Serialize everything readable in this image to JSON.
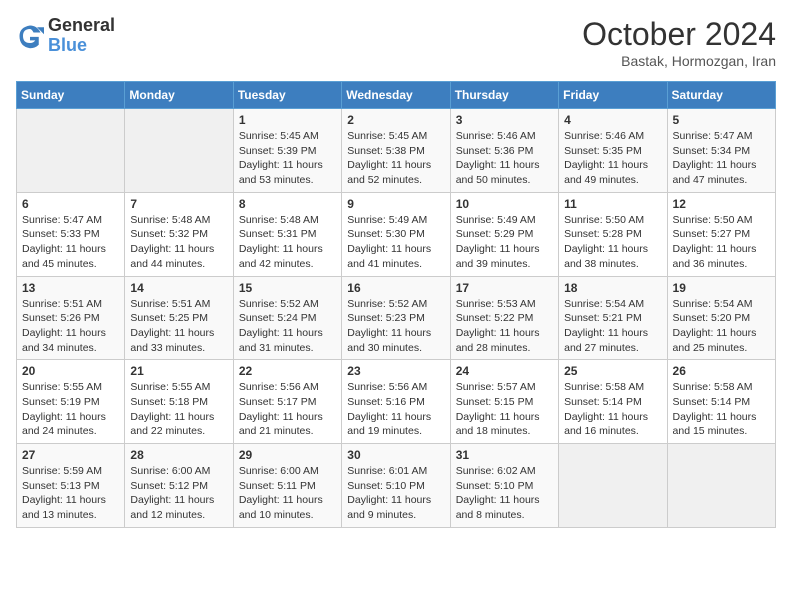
{
  "logo": {
    "line1": "General",
    "line2": "Blue"
  },
  "title": "October 2024",
  "subtitle": "Bastak, Hormozgan, Iran",
  "days_of_week": [
    "Sunday",
    "Monday",
    "Tuesday",
    "Wednesday",
    "Thursday",
    "Friday",
    "Saturday"
  ],
  "weeks": [
    [
      {
        "day": "",
        "info": ""
      },
      {
        "day": "",
        "info": ""
      },
      {
        "day": "1",
        "info": "Sunrise: 5:45 AM\nSunset: 5:39 PM\nDaylight: 11 hours and 53 minutes."
      },
      {
        "day": "2",
        "info": "Sunrise: 5:45 AM\nSunset: 5:38 PM\nDaylight: 11 hours and 52 minutes."
      },
      {
        "day": "3",
        "info": "Sunrise: 5:46 AM\nSunset: 5:36 PM\nDaylight: 11 hours and 50 minutes."
      },
      {
        "day": "4",
        "info": "Sunrise: 5:46 AM\nSunset: 5:35 PM\nDaylight: 11 hours and 49 minutes."
      },
      {
        "day": "5",
        "info": "Sunrise: 5:47 AM\nSunset: 5:34 PM\nDaylight: 11 hours and 47 minutes."
      }
    ],
    [
      {
        "day": "6",
        "info": "Sunrise: 5:47 AM\nSunset: 5:33 PM\nDaylight: 11 hours and 45 minutes."
      },
      {
        "day": "7",
        "info": "Sunrise: 5:48 AM\nSunset: 5:32 PM\nDaylight: 11 hours and 44 minutes."
      },
      {
        "day": "8",
        "info": "Sunrise: 5:48 AM\nSunset: 5:31 PM\nDaylight: 11 hours and 42 minutes."
      },
      {
        "day": "9",
        "info": "Sunrise: 5:49 AM\nSunset: 5:30 PM\nDaylight: 11 hours and 41 minutes."
      },
      {
        "day": "10",
        "info": "Sunrise: 5:49 AM\nSunset: 5:29 PM\nDaylight: 11 hours and 39 minutes."
      },
      {
        "day": "11",
        "info": "Sunrise: 5:50 AM\nSunset: 5:28 PM\nDaylight: 11 hours and 38 minutes."
      },
      {
        "day": "12",
        "info": "Sunrise: 5:50 AM\nSunset: 5:27 PM\nDaylight: 11 hours and 36 minutes."
      }
    ],
    [
      {
        "day": "13",
        "info": "Sunrise: 5:51 AM\nSunset: 5:26 PM\nDaylight: 11 hours and 34 minutes."
      },
      {
        "day": "14",
        "info": "Sunrise: 5:51 AM\nSunset: 5:25 PM\nDaylight: 11 hours and 33 minutes."
      },
      {
        "day": "15",
        "info": "Sunrise: 5:52 AM\nSunset: 5:24 PM\nDaylight: 11 hours and 31 minutes."
      },
      {
        "day": "16",
        "info": "Sunrise: 5:52 AM\nSunset: 5:23 PM\nDaylight: 11 hours and 30 minutes."
      },
      {
        "day": "17",
        "info": "Sunrise: 5:53 AM\nSunset: 5:22 PM\nDaylight: 11 hours and 28 minutes."
      },
      {
        "day": "18",
        "info": "Sunrise: 5:54 AM\nSunset: 5:21 PM\nDaylight: 11 hours and 27 minutes."
      },
      {
        "day": "19",
        "info": "Sunrise: 5:54 AM\nSunset: 5:20 PM\nDaylight: 11 hours and 25 minutes."
      }
    ],
    [
      {
        "day": "20",
        "info": "Sunrise: 5:55 AM\nSunset: 5:19 PM\nDaylight: 11 hours and 24 minutes."
      },
      {
        "day": "21",
        "info": "Sunrise: 5:55 AM\nSunset: 5:18 PM\nDaylight: 11 hours and 22 minutes."
      },
      {
        "day": "22",
        "info": "Sunrise: 5:56 AM\nSunset: 5:17 PM\nDaylight: 11 hours and 21 minutes."
      },
      {
        "day": "23",
        "info": "Sunrise: 5:56 AM\nSunset: 5:16 PM\nDaylight: 11 hours and 19 minutes."
      },
      {
        "day": "24",
        "info": "Sunrise: 5:57 AM\nSunset: 5:15 PM\nDaylight: 11 hours and 18 minutes."
      },
      {
        "day": "25",
        "info": "Sunrise: 5:58 AM\nSunset: 5:14 PM\nDaylight: 11 hours and 16 minutes."
      },
      {
        "day": "26",
        "info": "Sunrise: 5:58 AM\nSunset: 5:14 PM\nDaylight: 11 hours and 15 minutes."
      }
    ],
    [
      {
        "day": "27",
        "info": "Sunrise: 5:59 AM\nSunset: 5:13 PM\nDaylight: 11 hours and 13 minutes."
      },
      {
        "day": "28",
        "info": "Sunrise: 6:00 AM\nSunset: 5:12 PM\nDaylight: 11 hours and 12 minutes."
      },
      {
        "day": "29",
        "info": "Sunrise: 6:00 AM\nSunset: 5:11 PM\nDaylight: 11 hours and 10 minutes."
      },
      {
        "day": "30",
        "info": "Sunrise: 6:01 AM\nSunset: 5:10 PM\nDaylight: 11 hours and 9 minutes."
      },
      {
        "day": "31",
        "info": "Sunrise: 6:02 AM\nSunset: 5:10 PM\nDaylight: 11 hours and 8 minutes."
      },
      {
        "day": "",
        "info": ""
      },
      {
        "day": "",
        "info": ""
      }
    ]
  ]
}
